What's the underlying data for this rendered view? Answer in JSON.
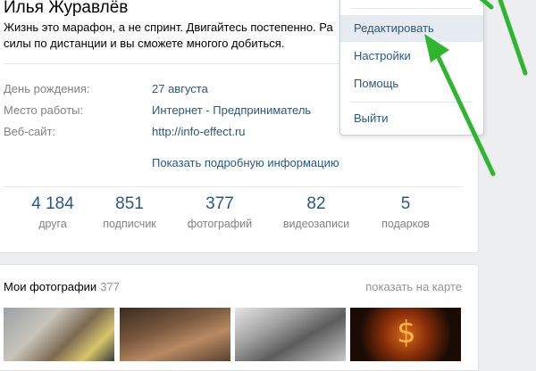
{
  "profile": {
    "name": "Илья Журавлёв",
    "status": "Жизнь это марафон, а не спринт. Двигайтесь постепенно. Ра",
    "status_line2": "силы по дистанции и вы сможете многого добиться.",
    "info": [
      {
        "label": "День рождения:",
        "value": "27 августа"
      },
      {
        "label": "Место работы:",
        "value": "Интернет - Предприниматель"
      },
      {
        "label": "Веб-сайт:",
        "value": "http://info-effect.ru"
      }
    ],
    "more_link": "Показать подробную информацию",
    "counters": [
      {
        "value": "4 184",
        "label": "друга"
      },
      {
        "value": "851",
        "label": "подписчик"
      },
      {
        "value": "377",
        "label": "фотографий"
      },
      {
        "value": "82",
        "label": "видеозаписи"
      },
      {
        "value": "5",
        "label": "подарков"
      }
    ]
  },
  "photos": {
    "title": "Мои фотографии",
    "count": "377",
    "map_link": "показать на карте"
  },
  "menu": {
    "items": [
      {
        "label": "Редактировать",
        "active": true
      },
      {
        "label": "Настройки",
        "active": false
      },
      {
        "label": "Помощь",
        "active": false
      },
      {
        "label": "Выйти",
        "active": false
      }
    ]
  },
  "colors": {
    "link": "#2a5885",
    "muted": "#828282",
    "annotation_arrow": "#2fb52f",
    "page_bg": "#edeef0",
    "menu_highlight": "#e5ebf1"
  }
}
